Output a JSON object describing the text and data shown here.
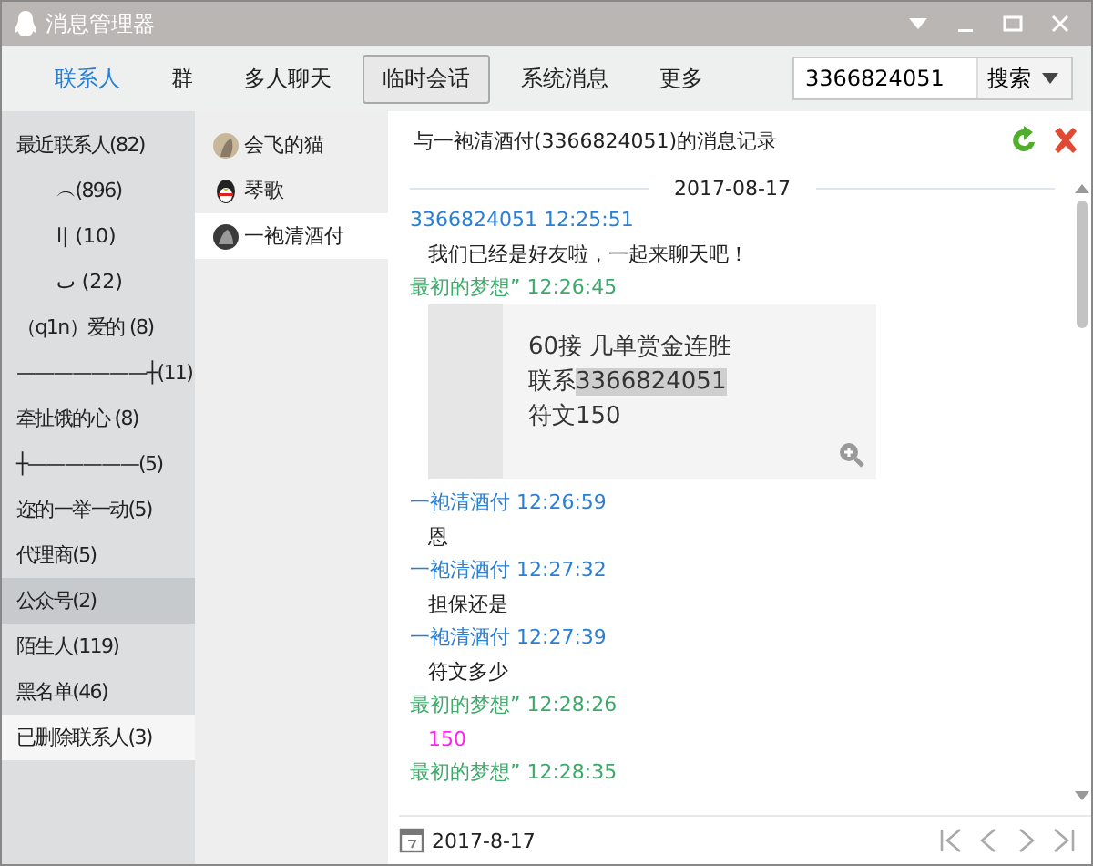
{
  "window": {
    "title": "消息管理器"
  },
  "tabs": [
    {
      "label": "联系人",
      "selected": false,
      "kind": "link"
    },
    {
      "label": "群",
      "selected": false,
      "kind": "plain"
    },
    {
      "label": "多人聊天",
      "selected": false,
      "kind": "plain"
    },
    {
      "label": "临时会话",
      "selected": true,
      "kind": "plain"
    },
    {
      "label": "系统消息",
      "selected": false,
      "kind": "plain"
    },
    {
      "label": "更多",
      "selected": false,
      "kind": "plain"
    }
  ],
  "search": {
    "value": "3366824051",
    "button": "搜索"
  },
  "groups": [
    {
      "label": "最近联系人(82)",
      "selected": false,
      "hovered": false,
      "centered": false
    },
    {
      "label": "︵(896)",
      "selected": false,
      "hovered": false,
      "centered": true
    },
    {
      "label": "ا|    (10)",
      "selected": false,
      "hovered": false,
      "centered": true
    },
    {
      "label": "ٮ    (22)",
      "selected": false,
      "hovered": false,
      "centered": true
    },
    {
      "label": "（q1n）爱的 (8)",
      "selected": false,
      "hovered": false,
      "centered": false
    },
    {
      "label": "———————┼(11)",
      "selected": false,
      "hovered": false,
      "centered": false
    },
    {
      "label": "牵扯饿的心  (8)",
      "selected": false,
      "hovered": false,
      "centered": false
    },
    {
      "label": "┼——————(5)",
      "selected": false,
      "hovered": false,
      "centered": false
    },
    {
      "label": "迩的一举一动(5)",
      "selected": false,
      "hovered": false,
      "centered": false
    },
    {
      "label": "代理商(5)",
      "selected": false,
      "hovered": false,
      "centered": false
    },
    {
      "label": "公众号(2)",
      "selected": false,
      "hovered": true,
      "centered": false
    },
    {
      "label": "陌生人(119)",
      "selected": false,
      "hovered": false,
      "centered": false
    },
    {
      "label": "黑名单(46)",
      "selected": false,
      "hovered": false,
      "centered": false
    },
    {
      "label": "已删除联系人(3)",
      "selected": true,
      "hovered": false,
      "centered": false
    }
  ],
  "contacts": [
    {
      "name": "会飞的猫",
      "kind": "photo",
      "selected": false
    },
    {
      "name": "琴歌",
      "kind": "penguin",
      "selected": false
    },
    {
      "name": "一袍清酒付",
      "kind": "dark",
      "selected": true
    }
  ],
  "record": {
    "title": "与一袍清酒付(3366824051)的消息记录",
    "date": "2017-08-17"
  },
  "messages": [
    {
      "sender": {
        "label": "3366824051 12:25:51",
        "color": "#2a7fd4"
      },
      "kind": "text",
      "text": "我们已经是好友啦，一起来聊天吧！"
    },
    {
      "sender": {
        "label": "最初的梦想” 12:26:45",
        "color": "#3daa6a"
      },
      "kind": "image",
      "lines": [
        {
          "text": "60接  几单赏金连胜"
        },
        {
          "text": "联系",
          "highlight": "3366824051"
        },
        {
          "text": "符文150"
        }
      ]
    },
    {
      "sender": {
        "label": "一袍清酒付 12:26:59",
        "color": "#2a7fd4"
      },
      "kind": "text",
      "text": "恩"
    },
    {
      "sender": {
        "label": "一袍清酒付 12:27:32",
        "color": "#2a7fd4"
      },
      "kind": "text",
      "text": "担保还是"
    },
    {
      "sender": {
        "label": "一袍清酒付 12:27:39",
        "color": "#2a7fd4"
      },
      "kind": "text",
      "text": "符文多少"
    },
    {
      "sender": {
        "label": "最初的梦想” 12:28:26",
        "color": "#3daa6a"
      },
      "kind": "text",
      "text": "150",
      "color": "#ff22ee"
    },
    {
      "sender": {
        "label": "最初的梦想” 12:28:35",
        "color": "#3daa6a"
      },
      "kind": "empty"
    }
  ],
  "footer": {
    "date": "2017-8-17"
  }
}
